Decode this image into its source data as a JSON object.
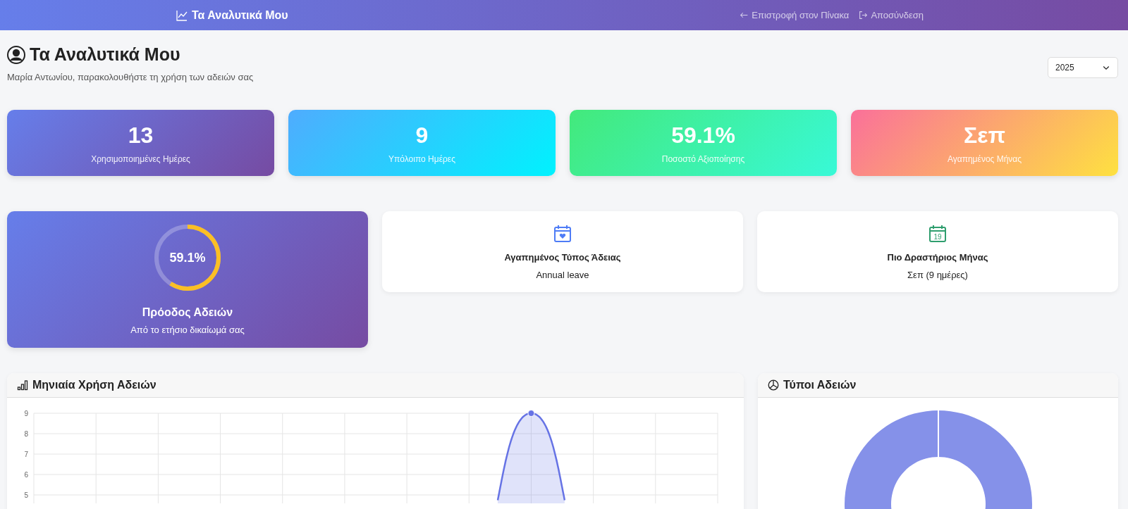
{
  "navbar": {
    "brand": "Τα Αναλυτικά Μου",
    "links": [
      {
        "label": "Επιστροφή στον Πίνακα",
        "kind": "back"
      },
      {
        "label": "Αποσύνδεση",
        "kind": "logout"
      }
    ]
  },
  "header": {
    "title": "Τα Αναλυτικά Μου",
    "subtitle": "Μαρία Αντωνίου, παρακολουθήστε τη χρήση των αδειών σας",
    "year_select": {
      "value": "2025"
    }
  },
  "stats": [
    {
      "value": "13",
      "label": "Χρησιμοποιημένες Ημέρες",
      "kind": "primary"
    },
    {
      "value": "9",
      "label": "Υπόλοιπο Ημέρες",
      "kind": "info"
    },
    {
      "value": "59.1%",
      "label": "Ποσοστό Αξιοποίησης",
      "kind": "success"
    },
    {
      "value": "Σεπ",
      "label": "Αγαπημένος Μήνας",
      "kind": "warning"
    }
  ],
  "progress": {
    "reading": "59.1%",
    "level": 0.591,
    "title": "Πρόοδος Αδειών",
    "subtitle": "Από το ετήσιο δικαίωμά σας"
  },
  "insights": [
    {
      "title": "Αγαπημένος Τύπος Άδειας",
      "value": "Annual leave",
      "kind": "heart"
    },
    {
      "title": "Πιο Δραστήριος Μήνας",
      "value": "Σεπ (9 ημέρες)",
      "kind": "date",
      "day": "19"
    }
  ],
  "monthly_card": {
    "title": "Μηνιαία Χρήση Αδειών",
    "chart": {
      "y_labels": [
        "9",
        "8",
        "7",
        "6",
        "5"
      ]
    }
  },
  "types_card": {
    "title": "Τύποι Αδειών"
  }
}
